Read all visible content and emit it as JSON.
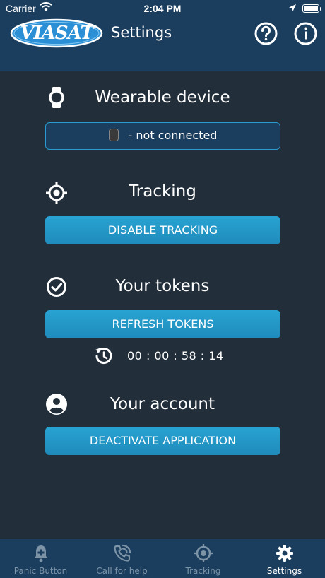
{
  "status_bar": {
    "carrier": "Carrier",
    "time": "2:04 PM"
  },
  "header": {
    "logo_text": "VIASAT",
    "title": "Settings",
    "help_icon": "question-circle-icon",
    "info_icon": "info-circle-icon"
  },
  "sections": {
    "wearable": {
      "icon": "watch-icon",
      "title": "Wearable device",
      "status_text": "- not connected"
    },
    "tracking": {
      "icon": "crosshair-icon",
      "title": "Tracking",
      "button_label": "DISABLE TRACKING"
    },
    "tokens": {
      "icon": "check-circle-icon",
      "title": "Your tokens",
      "button_label": "REFRESH TOKENS",
      "countdown": "00 : 00 : 58 : 14",
      "countdown_icon": "refresh-timer-icon"
    },
    "account": {
      "icon": "user-circle-icon",
      "title": "Your account",
      "button_label": "DEACTIVATE APPLICATION"
    }
  },
  "tab_bar": {
    "tabs": [
      {
        "label": "Panic Button",
        "icon": "bell-plus-icon",
        "active": false
      },
      {
        "label": "Call for help",
        "icon": "phone-call-icon",
        "active": false
      },
      {
        "label": "Tracking",
        "icon": "crosshair-icon",
        "active": false
      },
      {
        "label": "Settings",
        "icon": "gear-icon",
        "active": true
      }
    ]
  },
  "colors": {
    "background": "#222e3a",
    "header": "#1b3d5e",
    "accent": "#28a3d2",
    "inactive_tab": "#7d94a7"
  }
}
